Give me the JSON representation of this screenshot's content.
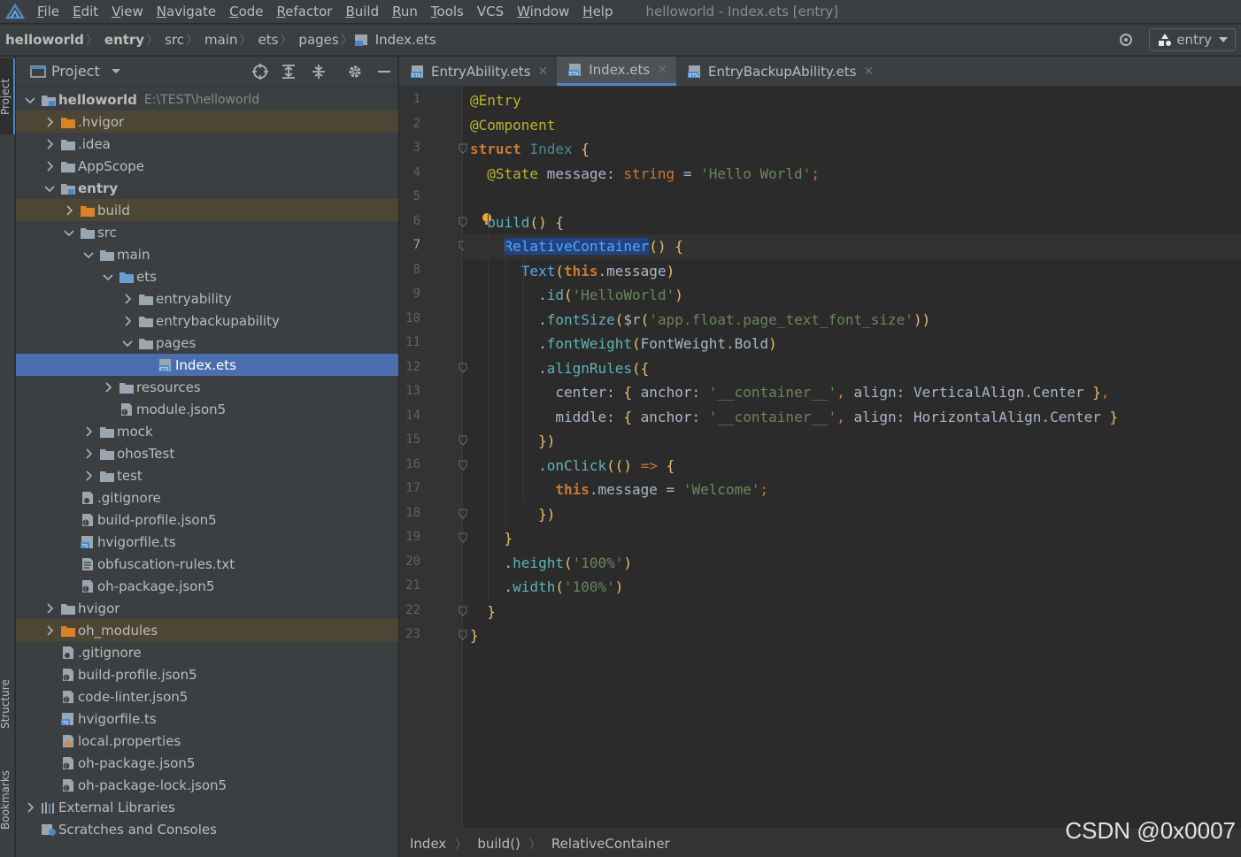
{
  "menu": {
    "items": [
      {
        "mnemonic": "F",
        "rest": "ile"
      },
      {
        "mnemonic": "E",
        "rest": "dit"
      },
      {
        "mnemonic": "V",
        "rest": "iew"
      },
      {
        "mnemonic": "N",
        "rest": "avigate"
      },
      {
        "mnemonic": "C",
        "rest": "ode"
      },
      {
        "mnemonic": "R",
        "rest": "efactor"
      },
      {
        "mnemonic": "B",
        "rest": "uild"
      },
      {
        "mnemonic": "R",
        "rest": "un",
        "pre": ""
      },
      {
        "mnemonic": "T",
        "rest": "ools"
      },
      {
        "mnemonic": "",
        "rest": "VCS"
      },
      {
        "mnemonic": "W",
        "rest": "indow"
      },
      {
        "mnemonic": "H",
        "rest": "elp"
      }
    ],
    "window_title": "helloworld - Index.ets [entry]"
  },
  "nav": {
    "crumbs": [
      "helloworld",
      "entry",
      "src",
      "main",
      "ets",
      "pages",
      "Index.ets"
    ],
    "run_config": "entry"
  },
  "left_strip": {
    "project": "Project",
    "structure": "Structure",
    "bookmarks": "Bookmarks"
  },
  "project_panel": {
    "title": "Project",
    "root_label": "helloworld",
    "root_path": "E:\\TEST\\helloworld",
    "rows": [
      {
        "label": "helloworld",
        "depth": 0,
        "chev": "down",
        "icon": "module",
        "bold": true,
        "path": "E:\\TEST\\helloworld"
      },
      {
        "label": ".hvigor",
        "depth": 1,
        "chev": "right",
        "icon": "folder-orange",
        "excluded": true
      },
      {
        "label": ".idea",
        "depth": 1,
        "chev": "right",
        "icon": "folder"
      },
      {
        "label": "AppScope",
        "depth": 1,
        "chev": "right",
        "icon": "folder"
      },
      {
        "label": "entry",
        "depth": 1,
        "chev": "down",
        "icon": "module",
        "bold": true
      },
      {
        "label": "build",
        "depth": 2,
        "chev": "right",
        "icon": "folder-orange",
        "excluded": true
      },
      {
        "label": "src",
        "depth": 2,
        "chev": "down",
        "icon": "folder"
      },
      {
        "label": "main",
        "depth": 3,
        "chev": "down",
        "icon": "folder"
      },
      {
        "label": "ets",
        "depth": 4,
        "chev": "down",
        "icon": "folder-blue"
      },
      {
        "label": "entryability",
        "depth": 5,
        "chev": "right",
        "icon": "folder"
      },
      {
        "label": "entrybackupability",
        "depth": 5,
        "chev": "right",
        "icon": "folder"
      },
      {
        "label": "pages",
        "depth": 5,
        "chev": "down",
        "icon": "folder"
      },
      {
        "label": "Index.ets",
        "depth": 6,
        "chev": "none",
        "icon": "ets",
        "selected": true
      },
      {
        "label": "resources",
        "depth": 4,
        "chev": "right",
        "icon": "folder"
      },
      {
        "label": "module.json5",
        "depth": 4,
        "chev": "none",
        "icon": "json"
      },
      {
        "label": "mock",
        "depth": 3,
        "chev": "right",
        "icon": "folder"
      },
      {
        "label": "ohosTest",
        "depth": 3,
        "chev": "right",
        "icon": "folder"
      },
      {
        "label": "test",
        "depth": 3,
        "chev": "right",
        "icon": "folder"
      },
      {
        "label": ".gitignore",
        "depth": 3,
        "chev": "none",
        "icon": "file",
        "xoff": -22
      },
      {
        "label": "build-profile.json5",
        "depth": 3,
        "chev": "none",
        "icon": "json",
        "xoff": -22
      },
      {
        "label": "hvigorfile.ts",
        "depth": 3,
        "chev": "none",
        "icon": "ts",
        "xoff": -22
      },
      {
        "label": "obfuscation-rules.txt",
        "depth": 3,
        "chev": "none",
        "icon": "txt",
        "xoff": -22
      },
      {
        "label": "oh-package.json5",
        "depth": 3,
        "chev": "none",
        "icon": "json",
        "xoff": -22
      },
      {
        "label": "hvigor",
        "depth": 1,
        "chev": "right",
        "icon": "folder"
      },
      {
        "label": "oh_modules",
        "depth": 1,
        "chev": "right",
        "icon": "folder-orange",
        "excluded": true
      },
      {
        "label": ".gitignore",
        "depth": 2,
        "chev": "none",
        "icon": "file",
        "xoff": -22
      },
      {
        "label": "build-profile.json5",
        "depth": 2,
        "chev": "none",
        "icon": "json",
        "xoff": -22
      },
      {
        "label": "code-linter.json5",
        "depth": 2,
        "chev": "none",
        "icon": "json",
        "xoff": -22
      },
      {
        "label": "hvigorfile.ts",
        "depth": 2,
        "chev": "none",
        "icon": "ts",
        "xoff": -22
      },
      {
        "label": "local.properties",
        "depth": 2,
        "chev": "none",
        "icon": "props",
        "xoff": -22
      },
      {
        "label": "oh-package.json5",
        "depth": 2,
        "chev": "none",
        "icon": "json",
        "xoff": -22
      },
      {
        "label": "oh-package-lock.json5",
        "depth": 2,
        "chev": "none",
        "icon": "json",
        "xoff": -22
      },
      {
        "label": "External Libraries",
        "depth": 0,
        "chev": "right",
        "icon": "libs"
      },
      {
        "label": "Scratches and Consoles",
        "depth": 0,
        "chev": "none",
        "icon": "scratch",
        "xoff": 0
      }
    ]
  },
  "editor": {
    "tabs": [
      {
        "label": "EntryAbility.ets",
        "active": false
      },
      {
        "label": "Index.ets",
        "active": true
      },
      {
        "label": "EntryBackupAbility.ets",
        "active": false
      }
    ],
    "current_line": 7,
    "line_numbers": [
      "1",
      "2",
      "3",
      "4",
      "5",
      "6",
      "7",
      "8",
      "9",
      "10",
      "11",
      "12",
      "13",
      "14",
      "15",
      "16",
      "17",
      "18",
      "19",
      "20",
      "21",
      "22",
      "23"
    ],
    "lines": [
      "@Entry",
      "@Component",
      "struct Index {",
      "  @State message: string = 'Hello World';",
      "",
      "  build() {",
      "    RelativeContainer() {",
      "      Text(this.message)",
      "        .id('HelloWorld')",
      "        .fontSize($r('app.float.page_text_font_size'))",
      "        .fontWeight(FontWeight.Bold)",
      "        .alignRules({",
      "          center: { anchor: '__container__', align: VerticalAlign.Center },",
      "          middle: { anchor: '__container__', align: HorizontalAlign.Center }",
      "        })",
      "        .onClick(() => {",
      "          this.message = 'Welcome';",
      "        })",
      "    }",
      "    .height('100%')",
      "    .width('100%')",
      "  }",
      "}"
    ]
  },
  "footer": {
    "crumbs": [
      "Index",
      "build()",
      "RelativeContainer"
    ]
  },
  "watermark": "CSDN @0x0007",
  "colors": {
    "selection": "#4b6eaf",
    "excluded": "#4d4635",
    "accent": "#4a88c7",
    "keyword": "#cc7832",
    "string": "#6a8759",
    "annotation": "#bbb529"
  }
}
